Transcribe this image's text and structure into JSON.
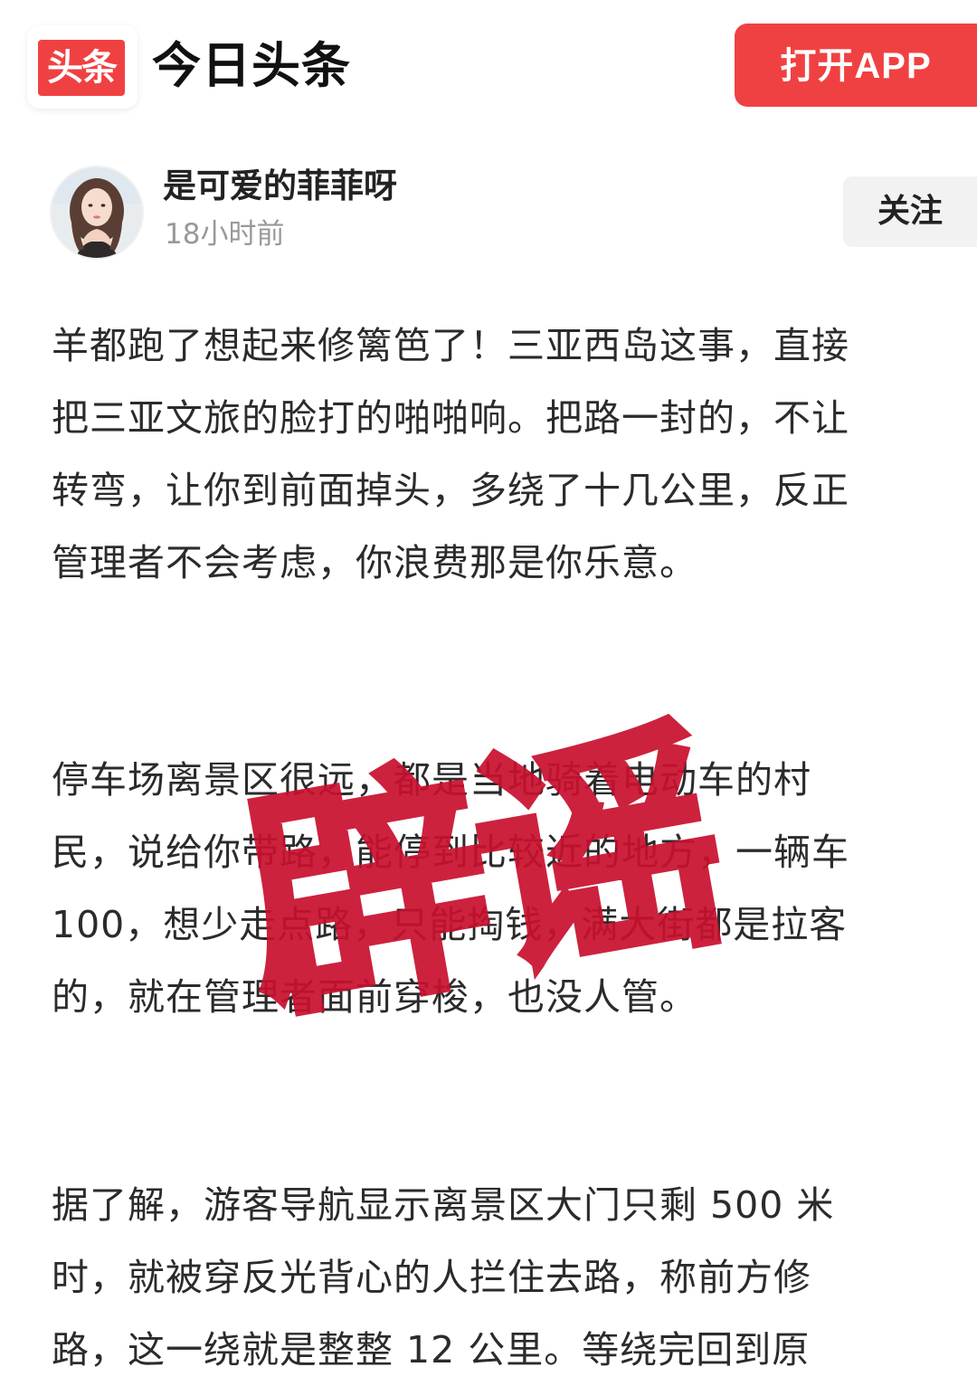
{
  "header": {
    "logo_text": "头条",
    "app_name": "今日头条",
    "open_app_label": "打开APP"
  },
  "author": {
    "name": "是可爱的菲菲呀",
    "time": "18小时前",
    "follow_label": "关注"
  },
  "article": {
    "paragraphs": [
      {
        "lines": [
          "羊都跑了想起来修篱笆了！三亚西岛这事，直接",
          "把三亚文旅的脸打的啪啪响。把路一封的，不让",
          "转弯，让你到前面掉头，多绕了十几公里，反正",
          "管理者不会考虑，你浪费那是你乐意。"
        ]
      },
      {
        "lines": [
          "停车场离景区很远，都是当地骑着电动车的村",
          "民，说给你带路，能停到比较近的地方，一辆车",
          "100，想少走点路，只能掏钱，满大街都是拉客",
          "的，就在管理者面前穿梭，也没人管。"
        ]
      },
      {
        "lines": [
          "据了解，游客导航显示离景区大门只剩 500 米",
          "时，就被穿反光背心的人拦住去路，称前方修",
          "路，这一绕就是整整 12 公里。等绕完回到原"
        ]
      }
    ]
  },
  "stamp": {
    "text": "辟谣",
    "color": "#c8102e"
  }
}
